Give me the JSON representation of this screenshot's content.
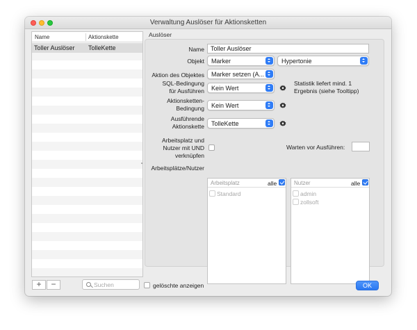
{
  "window": {
    "title": "Verwaltung Auslöser für Aktionsketten"
  },
  "list": {
    "columns": [
      "Name",
      "Aktionskette"
    ],
    "rows": [
      {
        "name": "Toller Auslöser",
        "chain": "TolleKette"
      }
    ],
    "add_label": "+",
    "remove_label": "−",
    "search_placeholder": "Suchen",
    "show_deleted_label": "gelöschte anzeigen"
  },
  "form": {
    "section_title": "Auslöser",
    "name_label": "Name",
    "name_value": "Toller Auslöser",
    "object_label": "Objekt",
    "object_value": "Marker",
    "object_sub_value": "Hypertonie",
    "action_label": "Aktion des Objektes",
    "action_value": "Marker setzen (A...",
    "sql_label_1": "SQL-Bedingung",
    "sql_label_2": "für Ausführen",
    "sql_value": "Kein Wert",
    "sql_hint_1": "Statistik liefert mind. 1",
    "sql_hint_2": "Ergebnis (siehe Tooltipp)",
    "chain_cond_label_1": "Aktionsketten-",
    "chain_cond_label_2": "Bedingung",
    "chain_cond_value": "Kein Wert",
    "exec_chain_label_1": "Ausführende",
    "exec_chain_label_2": "Aktionskette",
    "exec_chain_value": "TolleKette",
    "combine_label_1": "Arbeitsplatz und",
    "combine_label_2": "Nutzer mit UND",
    "combine_label_3": "verknüpfen",
    "wait_label": "Warten vor Ausführen:",
    "wait_value": "",
    "places_users_label": "Arbeitsplätze/Nutzer",
    "workplace_title": "Arbeitsplatz",
    "workplace_all": "alle",
    "workplaces": [
      "Standard"
    ],
    "user_title": "Nutzer",
    "user_all": "alle",
    "users": [
      "admin",
      "zollsoft"
    ]
  },
  "ok_label": "OK",
  "colors": {
    "accent": "#2f7cf6",
    "close": "#fe5f57",
    "minimize": "#febc2e",
    "maximize": "#28c840"
  }
}
